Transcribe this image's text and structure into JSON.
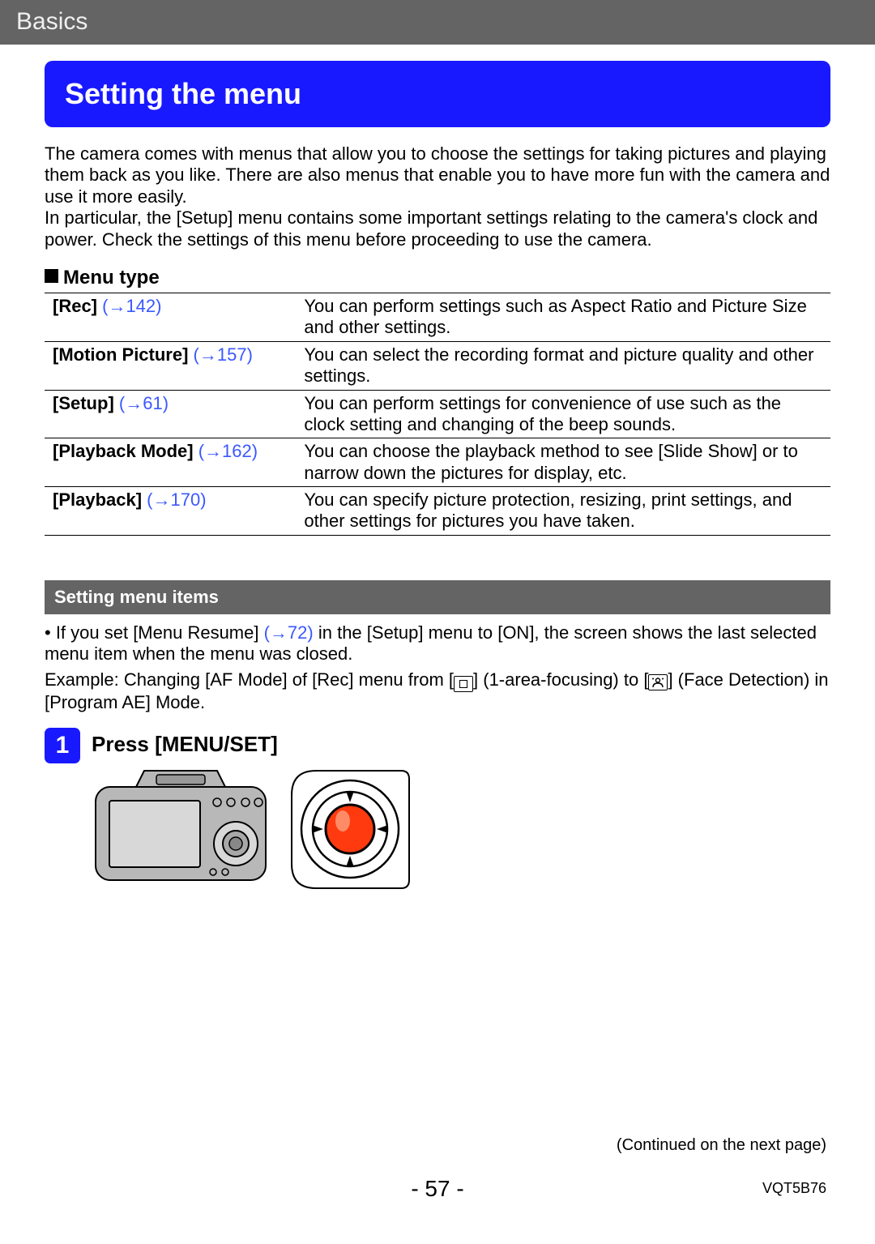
{
  "header": {
    "title": "Basics"
  },
  "main_title": "Setting the menu",
  "intro1": "The camera comes with menus that allow you to choose the settings for taking pictures and playing them back as you like. There are also menus that enable you to have more fun with the camera and use it more easily.",
  "intro2": "In particular, the [Setup] menu contains some important settings relating to the camera's clock and power. Check the settings of this menu before proceeding to use the camera.",
  "menu_type_head": "Menu type",
  "table": {
    "rows": [
      {
        "name": "[Rec] ",
        "link": "(→142)",
        "desc": "You can perform settings such as Aspect Ratio and Picture Size and other settings."
      },
      {
        "name": "[Motion Picture] ",
        "link": "(→157)",
        "desc": "You can select the recording format and picture quality and other settings."
      },
      {
        "name": "[Setup] ",
        "link": "(→61)",
        "desc": "You can perform settings for convenience of use such as the clock setting and changing of the beep sounds."
      },
      {
        "name": "[Playback Mode] ",
        "link": "(→162)",
        "desc": "You can choose the playback method to see [Slide Show] or to narrow down the pictures for display, etc."
      },
      {
        "name": "[Playback] ",
        "link": "(→170)",
        "desc": "You can specify picture protection, resizing, print settings, and other settings for pictures you have taken."
      }
    ]
  },
  "subheader2": "Setting menu items",
  "bullet_prefix": " • If you set [Menu Resume] ",
  "bullet_link": "(→72)",
  "bullet_suffix": " in the [Setup] menu to [ON], the screen shows the last selected menu item when the menu was closed.",
  "example_pre": "Example:  Changing [AF Mode] of [Rec] menu from [",
  "example_mid1": "] (1-area-focusing) to [",
  "example_mid2": "] (Face Detection) in [Program AE] Mode.",
  "step1": {
    "num": "1",
    "title": "Press [MENU/SET]"
  },
  "footer": {
    "continued": "(Continued on the next page)",
    "page": "- 57 -",
    "docid": "VQT5B76"
  }
}
